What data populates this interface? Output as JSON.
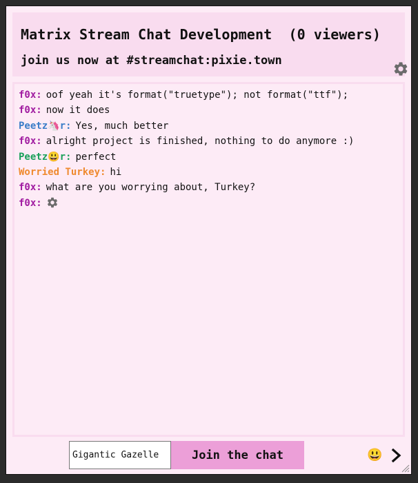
{
  "header": {
    "title": "Matrix Stream Chat Development  (0 viewers)",
    "subtitle": "join us now at #streamchat:pixie.town",
    "settings_icon": "gear-icon"
  },
  "messages": [
    {
      "author": "f0x:",
      "color": "#a01ba0",
      "text": "oof yeah it's format(\"truetype\"); not format(\"ttf\");"
    },
    {
      "author": "f0x:",
      "color": "#a01ba0",
      "text": "now it does"
    },
    {
      "author": "Peetz🦄r:",
      "color": "#3b7dc8",
      "text": "Yes, much better"
    },
    {
      "author": "f0x:",
      "color": "#a01ba0",
      "text": "alright project is finished, nothing to do anymore :)"
    },
    {
      "author": "Peetz😃r:",
      "color": "#1ba05a",
      "text": "perfect"
    },
    {
      "author": "Worried Turkey:",
      "color": "#ef8a2f",
      "text": "hi"
    },
    {
      "author": "f0x:",
      "color": "#a01ba0",
      "text": "what are you worrying about, Turkey?"
    },
    {
      "author": "f0x:",
      "color": "#a01ba0",
      "text": "",
      "icon": "gear-icon"
    }
  ],
  "footer": {
    "name_value": "Gigantic Gazelle",
    "join_label": "Join the chat",
    "emoji_label": "😃",
    "send_icon": "chevron-right-icon",
    "join_color": "#ec9fd8"
  }
}
